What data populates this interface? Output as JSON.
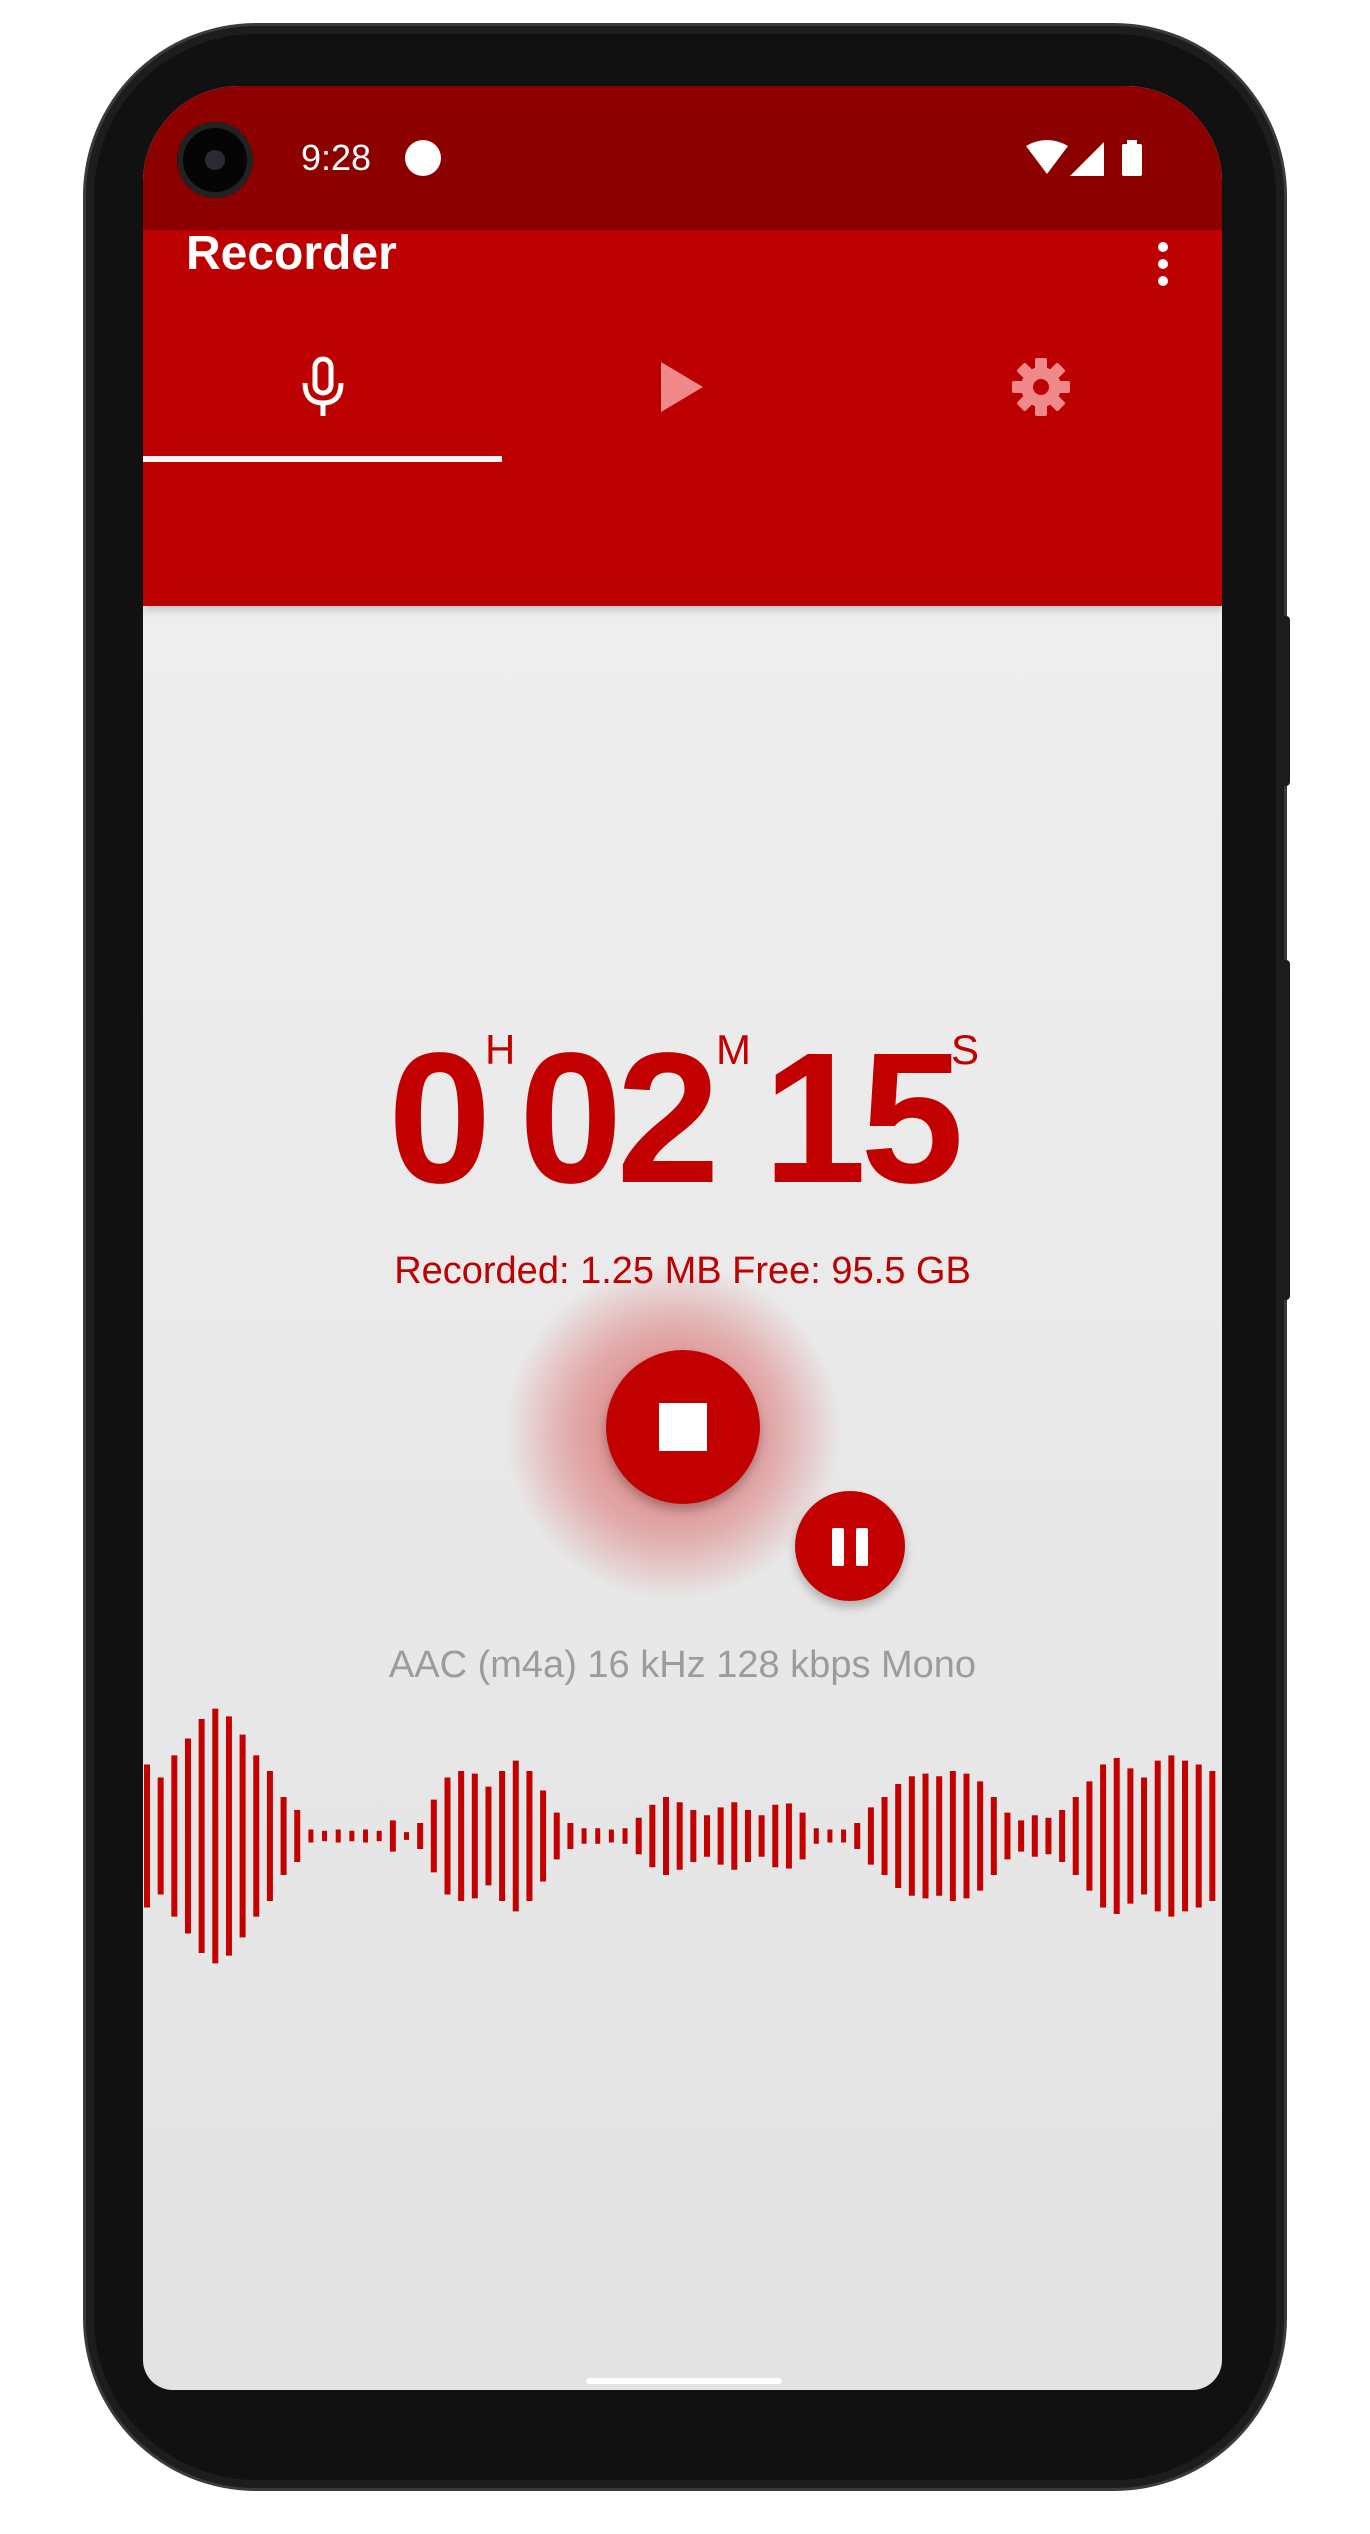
{
  "status_bar": {
    "time": "9:28",
    "icons": [
      "notification-dot-icon",
      "wifi-icon",
      "signal-icon",
      "battery-icon"
    ]
  },
  "app_bar": {
    "title": "Recorder",
    "menu_icon": "more-vert-icon",
    "tabs": [
      {
        "icon": "microphone-icon",
        "selected": true
      },
      {
        "icon": "play-icon",
        "selected": false
      },
      {
        "icon": "settings-gear-icon",
        "selected": false
      }
    ]
  },
  "timer": {
    "hours": "0",
    "hours_unit": "H",
    "minutes": "02",
    "minutes_unit": "M",
    "seconds": "15",
    "seconds_unit": "S"
  },
  "storage_info": "Recorded: 1.25 MB Free: 95.5 GB",
  "controls": {
    "stop_icon": "stop-icon",
    "pause_icon": "pause-icon"
  },
  "format_info": "AAC (m4a) 16 kHz 128 kbps Mono",
  "waveform": {
    "levels": [
      0.55,
      0.45,
      0.62,
      0.75,
      0.9,
      0.98,
      0.92,
      0.78,
      0.62,
      0.5,
      0.3,
      0.2,
      0.05,
      0.04,
      0.05,
      0.04,
      0.05,
      0.04,
      0.12,
      0.03,
      0.1,
      0.28,
      0.45,
      0.5,
      0.48,
      0.38,
      0.5,
      0.58,
      0.5,
      0.35,
      0.18,
      0.1,
      0.06,
      0.06,
      0.05,
      0.06,
      0.14,
      0.24,
      0.3,
      0.26,
      0.2,
      0.16,
      0.22,
      0.26,
      0.2,
      0.16,
      0.24,
      0.25,
      0.18,
      0.06,
      0.05,
      0.05,
      0.1,
      0.22,
      0.3,
      0.4,
      0.46,
      0.48,
      0.46,
      0.5,
      0.48,
      0.42,
      0.3,
      0.18,
      0.12,
      0.16,
      0.14,
      0.2,
      0.3,
      0.42,
      0.55,
      0.6,
      0.52,
      0.45,
      0.58,
      0.62,
      0.58,
      0.55,
      0.5
    ],
    "color": "#c40000"
  },
  "colors": {
    "status_bar": "#8d0000",
    "app_bar": "#bd0000",
    "accent": "#c20000",
    "background": "#ececec"
  }
}
